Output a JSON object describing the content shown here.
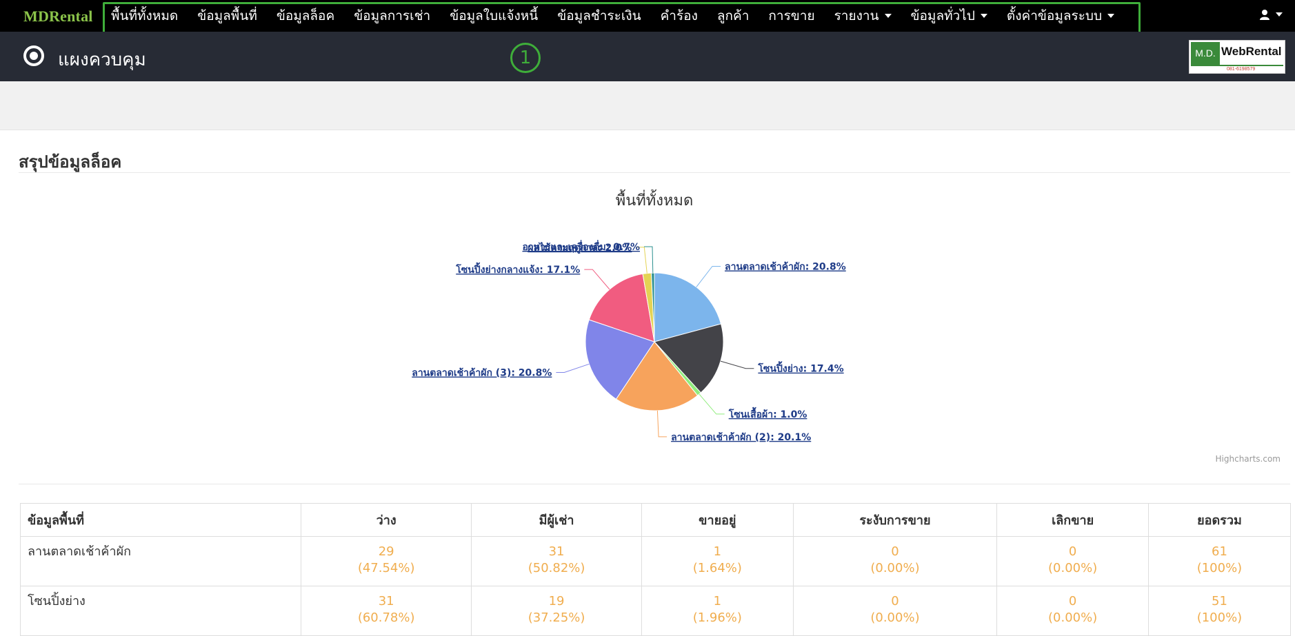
{
  "brand": "MDRental",
  "nav": [
    {
      "label": "พื้นที่ทั้งหมด",
      "dropdown": false
    },
    {
      "label": "ข้อมูลพื้นที่",
      "dropdown": false
    },
    {
      "label": "ข้อมูลล็อค",
      "dropdown": false
    },
    {
      "label": "ข้อมูลการเช่า",
      "dropdown": false
    },
    {
      "label": "ข้อมูลใบแจ้งหนี้",
      "dropdown": false
    },
    {
      "label": "ข้อมูลชำระเงิน",
      "dropdown": false
    },
    {
      "label": "คำร้อง",
      "dropdown": false
    },
    {
      "label": "ลูกค้า",
      "dropdown": false
    },
    {
      "label": "การขาย",
      "dropdown": false
    },
    {
      "label": "รายงาน",
      "dropdown": true
    },
    {
      "label": "ข้อมูลทั่วไป",
      "dropdown": true
    },
    {
      "label": "ตั้งค่าข้อมูลระบบ",
      "dropdown": true
    }
  ],
  "header": {
    "title": "แผงควบคุม",
    "step_marker": "1",
    "logo": {
      "left": "M.D.",
      "right": "WebRental",
      "phone": "081-6198579"
    }
  },
  "section": {
    "title": "สรุปข้อมูลล็อค"
  },
  "chart_data": {
    "type": "pie",
    "title": "พื้นที่ทั้งหมด",
    "credits": "Highcharts.com",
    "slices": [
      {
        "name": "ลานตลาดเช้าค้าผัก",
        "value": 20.8,
        "label": "ลานตลาดเช้าค้าผัก: 20.8%",
        "color": "#7cb5ec"
      },
      {
        "name": "โซนปิ้งย่าง",
        "value": 17.4,
        "label": "โซนปิ้งย่าง: 17.4%",
        "color": "#434348"
      },
      {
        "name": "โซนเสื้อผ้า",
        "value": 1.0,
        "label": "โซนเสื้อผ้า: 1.0%",
        "color": "#90ed7d"
      },
      {
        "name": "ลานตลาดเช้าค้าผัก (2)",
        "value": 20.1,
        "label": "ลานตลาดเช้าค้าผัก (2): 20.1%",
        "color": "#f7a35c"
      },
      {
        "name": "ลานตลาดเช้าค้าผัก (3)",
        "value": 20.8,
        "label": "ลานตลาดเช้าค้าผัก (3): 20.8%",
        "color": "#8085e9"
      },
      {
        "name": "โซนปิ้งย่างกลางแจ้ง",
        "value": 17.1,
        "label": "โซนปิ้งย่างกลางแจ้ง: 17.1%",
        "color": "#f15c80"
      },
      {
        "name": "ผลไม้ตามฤดูกาล",
        "value": 2.0,
        "label": "ผลไม้ตามฤดูกาล: 2.0%",
        "color": "#e4d354"
      },
      {
        "name": "อาหารและเครื่องดื่ม",
        "value": 0.7,
        "label": "อาหารและเครื่องดื่ม: 0.7%",
        "color": "#2b908f"
      }
    ]
  },
  "table": {
    "headers": [
      "ข้อมูลพื้นที่",
      "ว่าง",
      "มีผู้เช่า",
      "ขายอยู่",
      "ระงับการขาย",
      "เลิกขาย",
      "ยอดรวม"
    ],
    "rows": [
      {
        "name": "ลานตลาดเช้าค้าผัก",
        "cells": [
          [
            "29",
            "(47.54%)"
          ],
          [
            "31",
            "(50.82%)"
          ],
          [
            "1",
            "(1.64%)"
          ],
          [
            "0",
            "(0.00%)"
          ],
          [
            "0",
            "(0.00%)"
          ],
          [
            "61",
            "(100%)"
          ]
        ]
      },
      {
        "name": "โซนปิ้งย่าง",
        "cells": [
          [
            "31",
            "(60.78%)"
          ],
          [
            "19",
            "(37.25%)"
          ],
          [
            "1",
            "(1.96%)"
          ],
          [
            "0",
            "(0.00%)"
          ],
          [
            "0",
            "(0.00%)"
          ],
          [
            "51",
            "(100%)"
          ]
        ]
      }
    ]
  }
}
